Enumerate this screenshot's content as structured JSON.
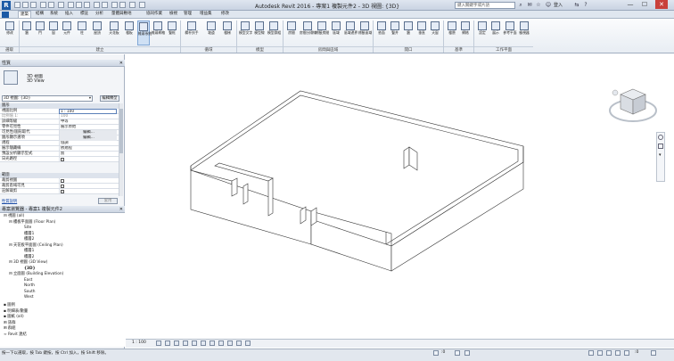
{
  "window": {
    "app_logo": "R",
    "title": "Autodesk Revit 2016 -    專案1 複製元件2 - 3D 視圖: {3D}",
    "search_placeholder": "鍵入關鍵字或片語",
    "login_label": "登入",
    "minimize": "—",
    "maximize": "☐",
    "close": "✕"
  },
  "tabs": [
    {
      "label": "建築"
    },
    {
      "label": "結構"
    },
    {
      "label": "系統"
    },
    {
      "label": "插入"
    },
    {
      "label": "標註"
    },
    {
      "label": "分析"
    },
    {
      "label": "量體與敷地"
    },
    {
      "label": "協同作業"
    },
    {
      "label": "檢視"
    },
    {
      "label": "管理"
    },
    {
      "label": "增益集"
    },
    {
      "label": "修改"
    }
  ],
  "ribbon": {
    "buttons": [
      {
        "label": "修改"
      },
      {
        "label": "牆"
      },
      {
        "label": "門"
      },
      {
        "label": "窗"
      },
      {
        "label": "元件"
      },
      {
        "label": "柱"
      },
      {
        "label": "屋頂"
      },
      {
        "label": "天花板"
      },
      {
        "label": "樓板"
      },
      {
        "label": "帷幕系統"
      },
      {
        "label": "帷幕網格"
      },
      {
        "label": "豎框"
      },
      {
        "label": "欄杆扶手"
      },
      {
        "label": "坡道"
      },
      {
        "label": "樓梯"
      },
      {
        "label": "模型文字"
      },
      {
        "label": "模型線"
      },
      {
        "label": "模型群組"
      },
      {
        "label": "房間"
      },
      {
        "label": "房間分隔線"
      },
      {
        "label": "標籤房間"
      },
      {
        "label": "區域"
      },
      {
        "label": "區域邊界"
      },
      {
        "label": "標籤區域"
      },
      {
        "label": "依面"
      },
      {
        "label": "豎井"
      },
      {
        "label": "牆"
      },
      {
        "label": "垂直"
      },
      {
        "label": "天窗"
      },
      {
        "label": "樓層"
      },
      {
        "label": "網格"
      },
      {
        "label": "設定"
      },
      {
        "label": "展示"
      },
      {
        "label": "參考平面"
      },
      {
        "label": "檢視器"
      }
    ],
    "panels": [
      {
        "label": "選取"
      },
      {
        "label": "建立"
      },
      {
        "label": "循環"
      },
      {
        "label": "模型"
      },
      {
        "label": "房間與區域"
      },
      {
        "label": "開口"
      },
      {
        "label": "基準"
      },
      {
        "label": "工作平面"
      }
    ]
  },
  "properties": {
    "header": "性質",
    "type_name_1": "3D 視圖",
    "type_name_2": "3D View",
    "type_selector": "3D 視圖: {3D}",
    "edit_type": "編輯類型",
    "category_graphics": "圖形",
    "rows": [
      {
        "name": "視圖比例",
        "value": "1 : 100"
      },
      {
        "name": "比例值 1:",
        "value": "100"
      },
      {
        "name": "詳細等級",
        "value": "中等"
      },
      {
        "name": "零件可見性",
        "value": "展示原始"
      },
      {
        "name": "可見性/圖形取代",
        "value": "編輯..."
      },
      {
        "name": "圖形顯示選項",
        "value": "編輯..."
      },
      {
        "name": "規程",
        "value": "協調"
      },
      {
        "name": "展示隱藏線",
        "value": "依規程"
      },
      {
        "name": "預設分析顯示型式",
        "value": "無"
      },
      {
        "name": "日光路徑",
        "value": ""
      }
    ],
    "category_extents": "範圍",
    "extent_rows": [
      {
        "name": "裁剪視圖",
        "value": ""
      },
      {
        "name": "裁剪區域可見",
        "value": ""
      },
      {
        "name": "註解裁剪",
        "value": ""
      }
    ],
    "help_link": "性質說明",
    "apply_button": "套用"
  },
  "project_browser": {
    "header": "專案瀏覽器 - 專案1 複製元件2",
    "items": [
      {
        "label": "視圖 (all)"
      },
      {
        "label": "樓板平面圖 (Floor Plan)"
      },
      {
        "label": "Site"
      },
      {
        "label": "樓層1"
      },
      {
        "label": "樓層2"
      },
      {
        "label": "天花板平面圖 (Ceiling Plan)"
      },
      {
        "label": "樓層1"
      },
      {
        "label": "樓層2"
      },
      {
        "label": "3D 視圖 (3D View)"
      },
      {
        "label": "{3D}"
      },
      {
        "label": "立面圖 (Building Elevation)"
      },
      {
        "label": "East"
      },
      {
        "label": "North"
      },
      {
        "label": "South"
      },
      {
        "label": "West"
      },
      {
        "label": "圖例"
      },
      {
        "label": "明細表/數量"
      },
      {
        "label": "圖紙 (all)"
      },
      {
        "label": "族群"
      },
      {
        "label": "群組"
      },
      {
        "label": "Revit 連結"
      }
    ]
  },
  "view_control_bar": {
    "scale": "1 : 100"
  },
  "status_bar": {
    "text": "按一下以選取，按 Tab 鍵按，按 Ctrl 加入，按 Shift 移除。",
    "zero": ":0"
  }
}
